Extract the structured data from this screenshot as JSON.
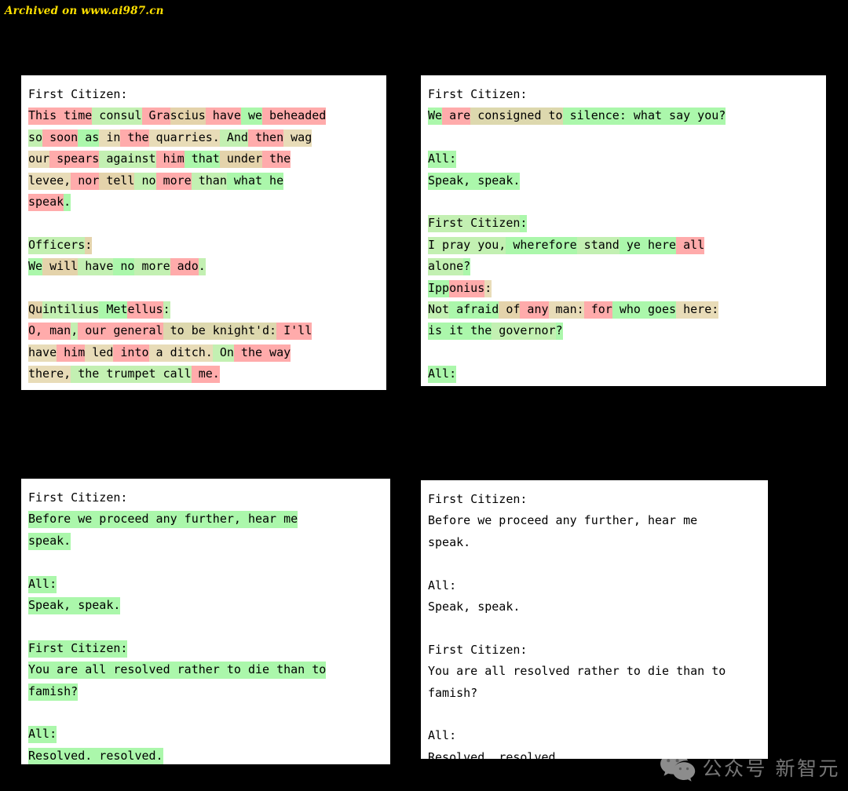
{
  "banner": {
    "text": "Archived on www.ai987.cn",
    "color": "#ffe000"
  },
  "watermark": {
    "icon": "wechat-icon",
    "label": "公众号  新智元",
    "color": "#d8d8d8"
  },
  "legend": {
    "red": "#ffabab",
    "green": "#abf7ab",
    "tan": "#e4d3ab",
    "none": "transparent",
    "panel_background": "#ffffff",
    "page_background": "#000000",
    "text_color": "#000000"
  },
  "panels": [
    {
      "id": "panel-1",
      "name": "sample-output-1",
      "lines": [
        [
          {
            "t": "First Citizen:",
            "h": "n"
          }
        ],
        [
          {
            "t": "This",
            "h": "r"
          },
          {
            "t": " time",
            "h": "r"
          },
          {
            "t": " consul",
            "h": "g2"
          },
          {
            "t": " Gra",
            "h": "r"
          },
          {
            "t": "scius",
            "h": "t"
          },
          {
            "t": " have",
            "h": "r"
          },
          {
            "t": " we",
            "h": "g"
          },
          {
            "t": " beheaded",
            "h": "r"
          }
        ],
        [
          {
            "t": "so",
            "h": "g2"
          },
          {
            "t": " soon",
            "h": "r"
          },
          {
            "t": " as",
            "h": "g"
          },
          {
            "t": " in",
            "h": "t3"
          },
          {
            "t": " the",
            "h": "r"
          },
          {
            "t": " quarries.",
            "h": "t3"
          },
          {
            "t": " And",
            "h": "g2"
          },
          {
            "t": " then",
            "h": "r"
          },
          {
            "t": " wag",
            "h": "t3"
          }
        ],
        [
          {
            "t": "our",
            "h": "t3"
          },
          {
            "t": " spears",
            "h": "r"
          },
          {
            "t": " against",
            "h": "g2"
          },
          {
            "t": " him",
            "h": "r"
          },
          {
            "t": " that",
            "h": "g"
          },
          {
            "t": " under",
            "h": "t"
          },
          {
            "t": " the",
            "h": "r"
          }
        ],
        [
          {
            "t": "levee,",
            "h": "t3"
          },
          {
            "t": " nor",
            "h": "r"
          },
          {
            "t": " tell",
            "h": "t"
          },
          {
            "t": " no",
            "h": "g2"
          },
          {
            "t": " more",
            "h": "r"
          },
          {
            "t": " than",
            "h": "g2"
          },
          {
            "t": " what",
            "h": "g"
          },
          {
            "t": " he",
            "h": "g"
          }
        ],
        [
          {
            "t": "speak",
            "h": "r"
          },
          {
            "t": ".",
            "h": "g"
          }
        ],
        [
          {
            "t": " ",
            "h": "n"
          }
        ],
        [
          {
            "t": "Officers",
            "h": "g2"
          },
          {
            "t": ":",
            "h": "t"
          }
        ],
        [
          {
            "t": "We",
            "h": "g"
          },
          {
            "t": " will",
            "h": "t"
          },
          {
            "t": " have",
            "h": "g2"
          },
          {
            "t": " no",
            "h": "g"
          },
          {
            "t": " more",
            "h": "g2"
          },
          {
            "t": " ado",
            "h": "r"
          },
          {
            "t": ".",
            "h": "g2"
          }
        ],
        [
          {
            "t": " ",
            "h": "n"
          }
        ],
        [
          {
            "t": "Qu",
            "h": "t"
          },
          {
            "t": "intilius",
            "h": "g2"
          },
          {
            "t": " Met",
            "h": "g"
          },
          {
            "t": "ellus",
            "h": "r"
          },
          {
            "t": ":",
            "h": "g2"
          }
        ],
        [
          {
            "t": "O,",
            "h": "r"
          },
          {
            "t": " man",
            "h": "r"
          },
          {
            "t": ",",
            "h": "g2"
          },
          {
            "t": " our",
            "h": "r"
          },
          {
            "t": " general",
            "h": "r"
          },
          {
            "t": " to",
            "h": "t2"
          },
          {
            "t": " be",
            "h": "t2"
          },
          {
            "t": " knight'd:",
            "h": "t2"
          },
          {
            "t": " I'll",
            "h": "r"
          }
        ],
        [
          {
            "t": "have",
            "h": "t3"
          },
          {
            "t": " him",
            "h": "r"
          },
          {
            "t": " led",
            "h": "t3"
          },
          {
            "t": " into",
            "h": "r"
          },
          {
            "t": " a",
            "h": "t3"
          },
          {
            "t": " ditch.",
            "h": "t3"
          },
          {
            "t": " On",
            "h": "g2"
          },
          {
            "t": " the",
            "h": "r"
          },
          {
            "t": " way",
            "h": "r"
          }
        ],
        [
          {
            "t": "there,",
            "h": "t3"
          },
          {
            "t": " the",
            "h": "g2"
          },
          {
            "t": " trumpet",
            "h": "g2"
          },
          {
            "t": " call",
            "h": "g2"
          },
          {
            "t": " me.",
            "h": "r"
          }
        ]
      ]
    },
    {
      "id": "panel-2",
      "name": "sample-output-2",
      "lines": [
        [
          {
            "t": "First Citizen:",
            "h": "n"
          }
        ],
        [
          {
            "t": "We",
            "h": "g"
          },
          {
            "t": " are",
            "h": "r"
          },
          {
            "t": " con",
            "h": "t2"
          },
          {
            "t": "signed",
            "h": "t2"
          },
          {
            "t": " to",
            "h": "t2"
          },
          {
            "t": " silence:",
            "h": "g"
          },
          {
            "t": " what",
            "h": "g"
          },
          {
            "t": " say",
            "h": "g"
          },
          {
            "t": " you?",
            "h": "g"
          }
        ],
        [
          {
            "t": " ",
            "h": "n"
          }
        ],
        [
          {
            "t": "All:",
            "h": "g"
          }
        ],
        [
          {
            "t": "Speak, speak.",
            "h": "g"
          }
        ],
        [
          {
            "t": " ",
            "h": "n"
          }
        ],
        [
          {
            "t": "First Citizen",
            "h": "g2"
          },
          {
            "t": ":",
            "h": "g"
          }
        ],
        [
          {
            "t": "I",
            "h": "g2"
          },
          {
            "t": " pray",
            "h": "g2"
          },
          {
            "t": " you,",
            "h": "g2"
          },
          {
            "t": " wherefore",
            "h": "g"
          },
          {
            "t": " stand",
            "h": "g2"
          },
          {
            "t": " ye",
            "h": "g"
          },
          {
            "t": " here",
            "h": "g"
          },
          {
            "t": " all",
            "h": "r"
          }
        ],
        [
          {
            "t": "alone",
            "h": "g2"
          },
          {
            "t": "?",
            "h": "g"
          }
        ],
        [
          {
            "t": "Ipp",
            "h": "g"
          },
          {
            "t": "onius",
            "h": "r"
          },
          {
            "t": ":",
            "h": "t3"
          }
        ],
        [
          {
            "t": "Not",
            "h": "g2"
          },
          {
            "t": " afraid",
            "h": "g"
          },
          {
            "t": " of",
            "h": "t"
          },
          {
            "t": " any",
            "h": "r"
          },
          {
            "t": " man:",
            "h": "t3"
          },
          {
            "t": " for",
            "h": "r"
          },
          {
            "t": " who",
            "h": "g"
          },
          {
            "t": " goes",
            "h": "g"
          },
          {
            "t": " here:",
            "h": "t3"
          }
        ],
        [
          {
            "t": "is",
            "h": "g"
          },
          {
            "t": " it",
            "h": "g"
          },
          {
            "t": " the",
            "h": "g"
          },
          {
            "t": " governor",
            "h": "g2"
          },
          {
            "t": "?",
            "h": "g"
          }
        ],
        [
          {
            "t": " ",
            "h": "n"
          }
        ],
        [
          {
            "t": "All:",
            "h": "g"
          }
        ]
      ]
    },
    {
      "id": "panel-3",
      "name": "sample-output-3",
      "lines": [
        [
          {
            "t": "First Citizen:",
            "h": "n"
          }
        ],
        [
          {
            "t": "Before we proceed any further, hear me",
            "h": "g"
          }
        ],
        [
          {
            "t": "speak.",
            "h": "g"
          }
        ],
        [
          {
            "t": " ",
            "h": "n"
          }
        ],
        [
          {
            "t": "All:",
            "h": "g"
          }
        ],
        [
          {
            "t": "Speak, speak.",
            "h": "g"
          }
        ],
        [
          {
            "t": " ",
            "h": "n"
          }
        ],
        [
          {
            "t": "First Citizen:",
            "h": "g"
          }
        ],
        [
          {
            "t": "You are all resolved rather to die than to",
            "h": "g"
          }
        ],
        [
          {
            "t": "famish?",
            "h": "g"
          }
        ],
        [
          {
            "t": " ",
            "h": "n"
          }
        ],
        [
          {
            "t": "All:",
            "h": "g"
          }
        ],
        [
          {
            "t": "Resolved. resolved.",
            "h": "g"
          }
        ]
      ]
    },
    {
      "id": "panel-4",
      "name": "sample-output-4",
      "lines": [
        [
          {
            "t": "First Citizen:",
            "h": "n"
          }
        ],
        [
          {
            "t": "Before we proceed any further, hear me",
            "h": "n"
          }
        ],
        [
          {
            "t": "speak.",
            "h": "n"
          }
        ],
        [
          {
            "t": " ",
            "h": "n"
          }
        ],
        [
          {
            "t": "All:",
            "h": "n"
          }
        ],
        [
          {
            "t": "Speak, speak.",
            "h": "n"
          }
        ],
        [
          {
            "t": " ",
            "h": "n"
          }
        ],
        [
          {
            "t": "First Citizen:",
            "h": "n"
          }
        ],
        [
          {
            "t": "You are all resolved rather to die than to",
            "h": "n"
          }
        ],
        [
          {
            "t": "famish?",
            "h": "n"
          }
        ],
        [
          {
            "t": " ",
            "h": "n"
          }
        ],
        [
          {
            "t": "All:",
            "h": "n"
          }
        ],
        [
          {
            "t": "Resolved. resolved.",
            "h": "n"
          }
        ]
      ]
    }
  ]
}
